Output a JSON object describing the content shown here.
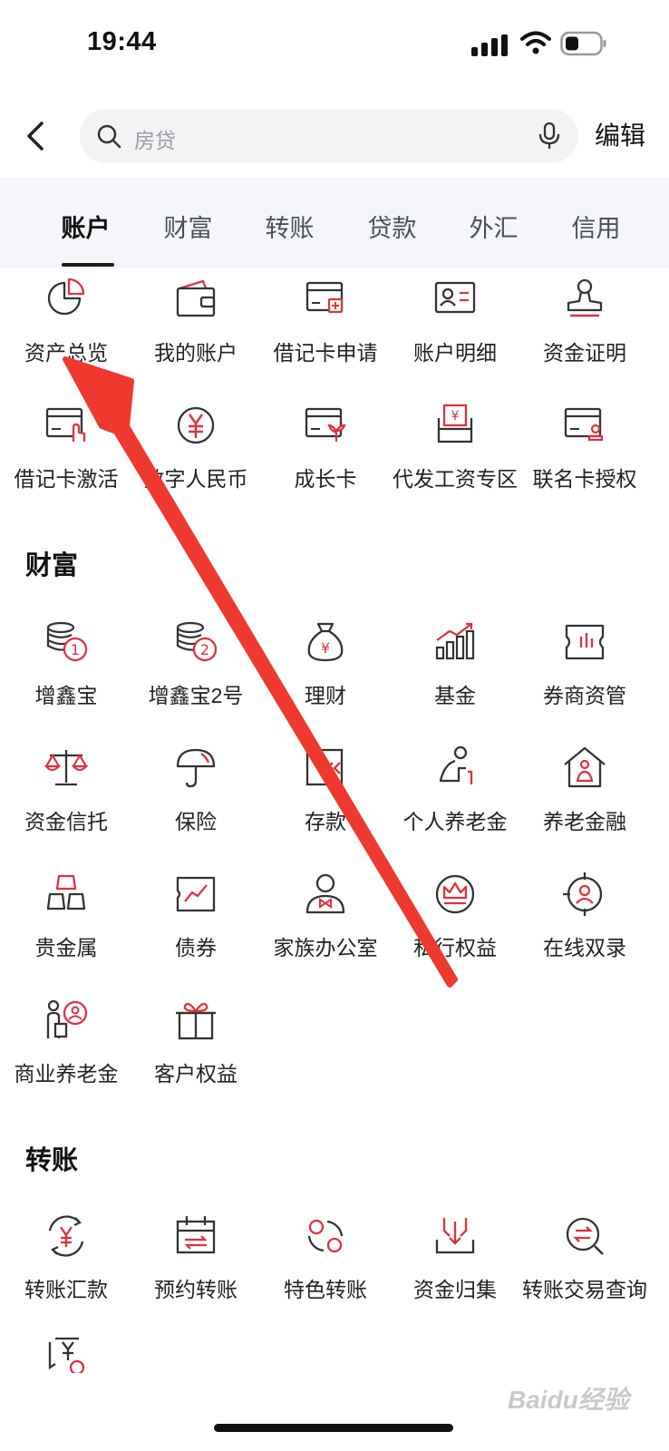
{
  "status": {
    "time": "19:44"
  },
  "search": {
    "placeholder": "房贷"
  },
  "header": {
    "edit_label": "编辑"
  },
  "tabs": [
    "账户",
    "财富",
    "转账",
    "贷款",
    "外汇",
    "信用"
  ],
  "account": {
    "items": [
      "资产总览",
      "我的账户",
      "借记卡申请",
      "账户明细",
      "资金证明",
      "借记卡激活",
      "数字人民币",
      "成长卡",
      "代发工资专区",
      "联名卡授权"
    ]
  },
  "wealth": {
    "title": "财富",
    "items": [
      "增鑫宝",
      "增鑫宝2号",
      "理财",
      "基金",
      "券商资管",
      "资金信托",
      "保险",
      "存款",
      "个人养老金",
      "养老金融",
      "贵金属",
      "债券",
      "家族办公室",
      "私行权益",
      "在线双录",
      "商业养老金",
      "客户权益"
    ]
  },
  "transfer": {
    "title": "转账",
    "items": [
      "转账汇款",
      "预约转账",
      "特色转账",
      "资金归集",
      "转账交易查询"
    ]
  },
  "watermark": "Baidu经验",
  "colors": {
    "accent": "#e0313e",
    "icon_dark": "#333333",
    "annotation_arrow": "#ee3a2e"
  }
}
